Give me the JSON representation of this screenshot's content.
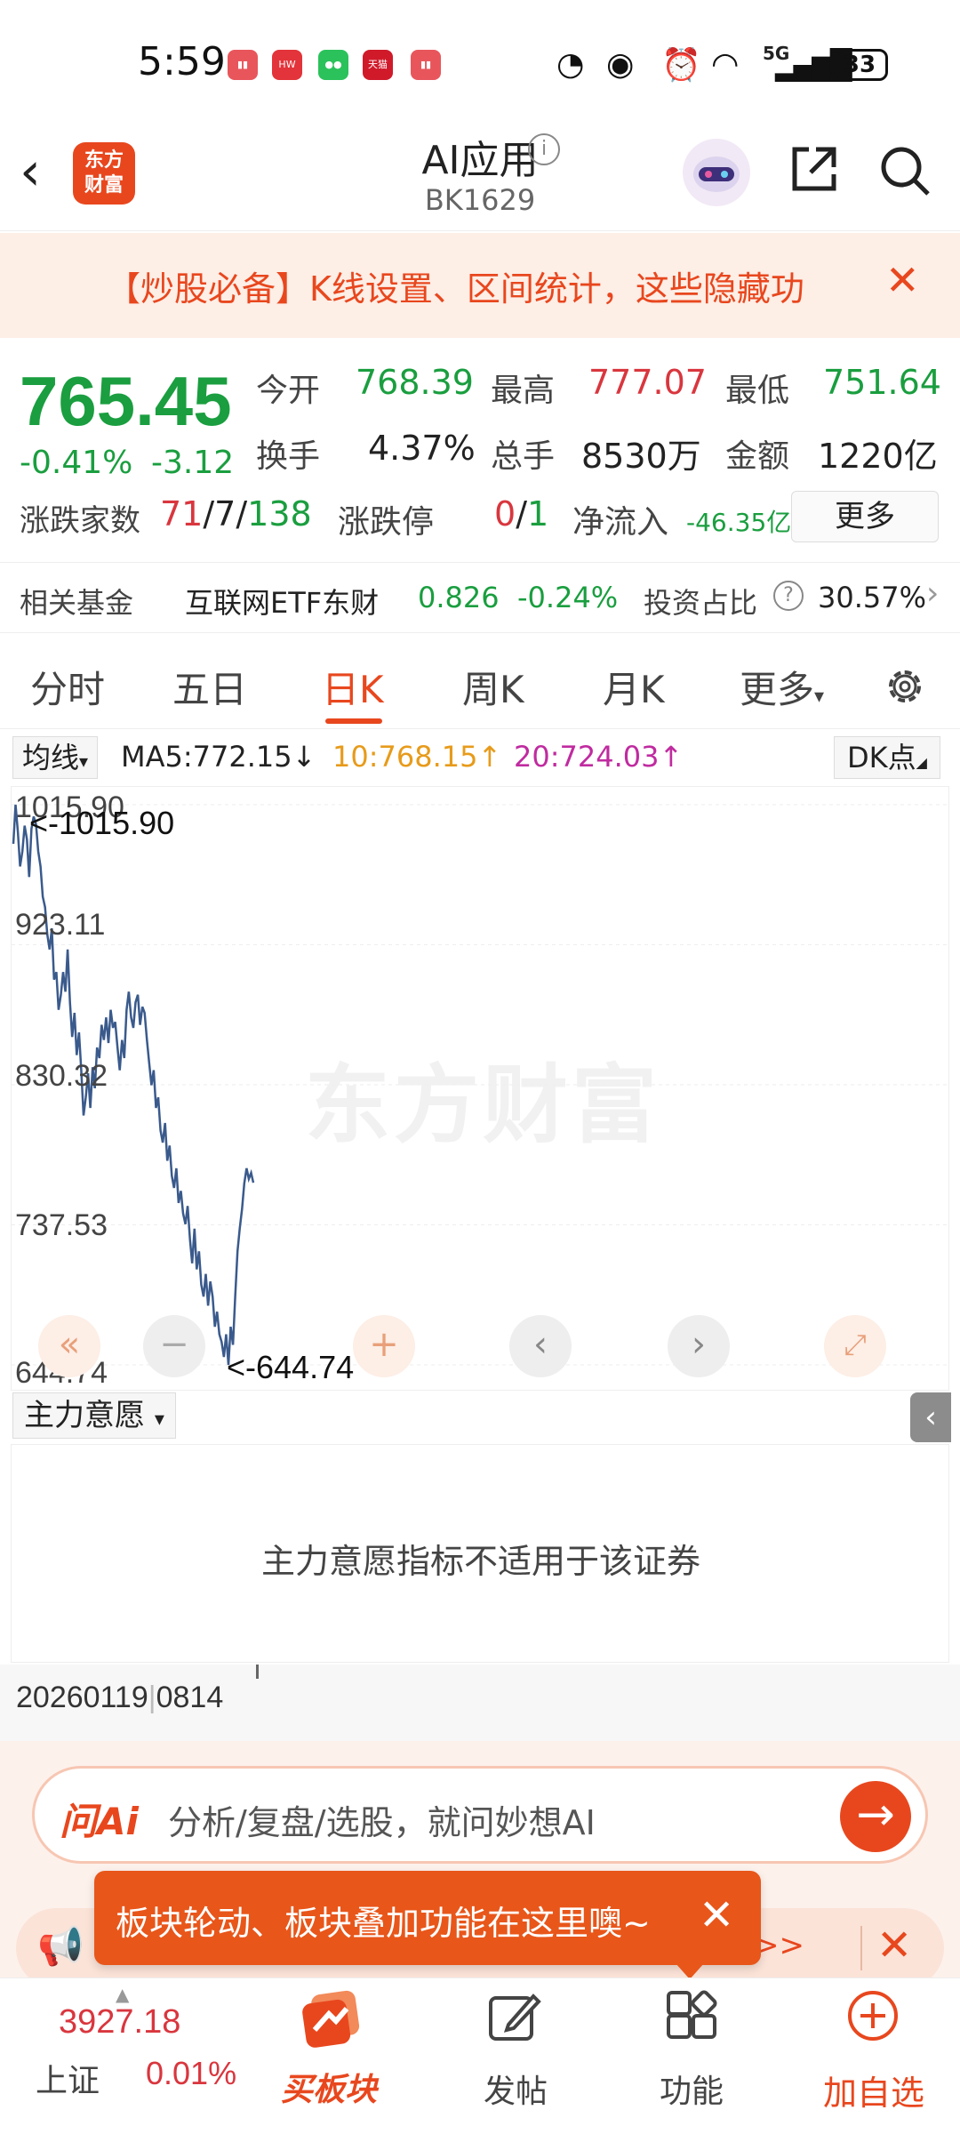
{
  "status_bar": {
    "time": "5:59",
    "battery": "33",
    "signal": "5G"
  },
  "header": {
    "title": "AI应用",
    "code": "BK1629",
    "logo_text": "东方财富"
  },
  "banner": {
    "text": "【炒股必备】K线设置、区间统计，这些隐藏功"
  },
  "quote": {
    "price": "765.45",
    "change_pct": "-0.41%",
    "change_abs": "-3.12",
    "open_label": "今开",
    "open": "768.39",
    "high_label": "最高",
    "high": "777.07",
    "low_label": "最低",
    "low": "751.64",
    "turnover_label": "换手",
    "turnover": "4.37%",
    "volume_label": "总手",
    "volume": "8530万",
    "amount_label": "金额",
    "amount": "1220亿",
    "breadth_label": "涨跌家数",
    "breadth_up": "71",
    "breadth_flat": "7",
    "breadth_down": "138",
    "limit_label": "涨跌停",
    "limit_up": "0",
    "limit_down": "1",
    "netflow_label": "净流入",
    "netflow": "-46.35亿",
    "more_label": "更多"
  },
  "fund": {
    "label": "相关基金",
    "name": "互联网ETF东财",
    "price": "0.826",
    "change": "-0.24%",
    "ratio_label": "投资占比",
    "ratio": "30.57%"
  },
  "tabs": {
    "items": [
      "分时",
      "五日",
      "日K",
      "周K",
      "月K",
      "更多"
    ],
    "active": 2
  },
  "ma": {
    "select_label": "均线",
    "ma5": "MA5:772.15",
    "ma10": "10:768.15",
    "ma20": "20:724.03",
    "dk_label": "DK点"
  },
  "chart_data": {
    "type": "line",
    "y_ticks": [
      "1015.90",
      "923.11",
      "830.32",
      "737.53",
      "644.74"
    ],
    "ylim": [
      644.74,
      1015.9
    ],
    "annotations": {
      "max": "<-1015.90",
      "min": "<-644.74"
    },
    "watermark": "东方财富",
    "series": [
      {
        "values": [
          990,
          1015.9,
          998,
          975,
          985,
          1002,
          993,
          968,
          1000,
          1008,
          1003,
          985,
          975,
          955,
          948,
          930,
          920,
          934,
          900,
          905,
          880,
          890,
          905,
          892,
          920,
          885,
          862,
          878,
          850,
          865,
          840,
          810,
          822,
          838,
          815,
          842,
          828,
          855,
          848,
          870,
          860,
          875,
          858,
          880,
          868,
          872,
          855,
          840,
          860,
          848,
          880,
          892,
          875,
          868,
          885,
          890,
          870,
          882,
          878,
          860,
          845,
          830,
          840,
          815,
          822,
          800,
          792,
          805,
          780,
          790,
          770,
          762,
          775,
          752,
          760,
          745,
          738,
          750,
          728,
          712,
          735,
          708,
          720,
          698,
          690,
          705,
          684,
          700,
          690,
          670,
          680,
          665,
          660,
          650,
          665,
          644.74,
          670,
          658,
          690,
          720,
          735,
          748,
          765,
          775,
          768,
          772,
          765.45
        ]
      }
    ]
  },
  "indicator": {
    "select_label": "主力意愿",
    "message": "主力意愿指标不适用于该证券",
    "date_text": "20260119",
    "date_text2": "0814"
  },
  "ask": {
    "logo": "问Ai",
    "placeholder": "分析/复盘/选股，就问妙想AI"
  },
  "tooltip": {
    "text": "板块轮动、板块叠加功能在这里噢~"
  },
  "notice": {
    "arrow": ">>"
  },
  "bottom_nav": {
    "index_value": "3927.18",
    "index_name": "上证",
    "index_change": "0.01%",
    "buy_label": "买板块",
    "post_label": "发帖",
    "func_label": "功能",
    "add_label": "加自选"
  }
}
